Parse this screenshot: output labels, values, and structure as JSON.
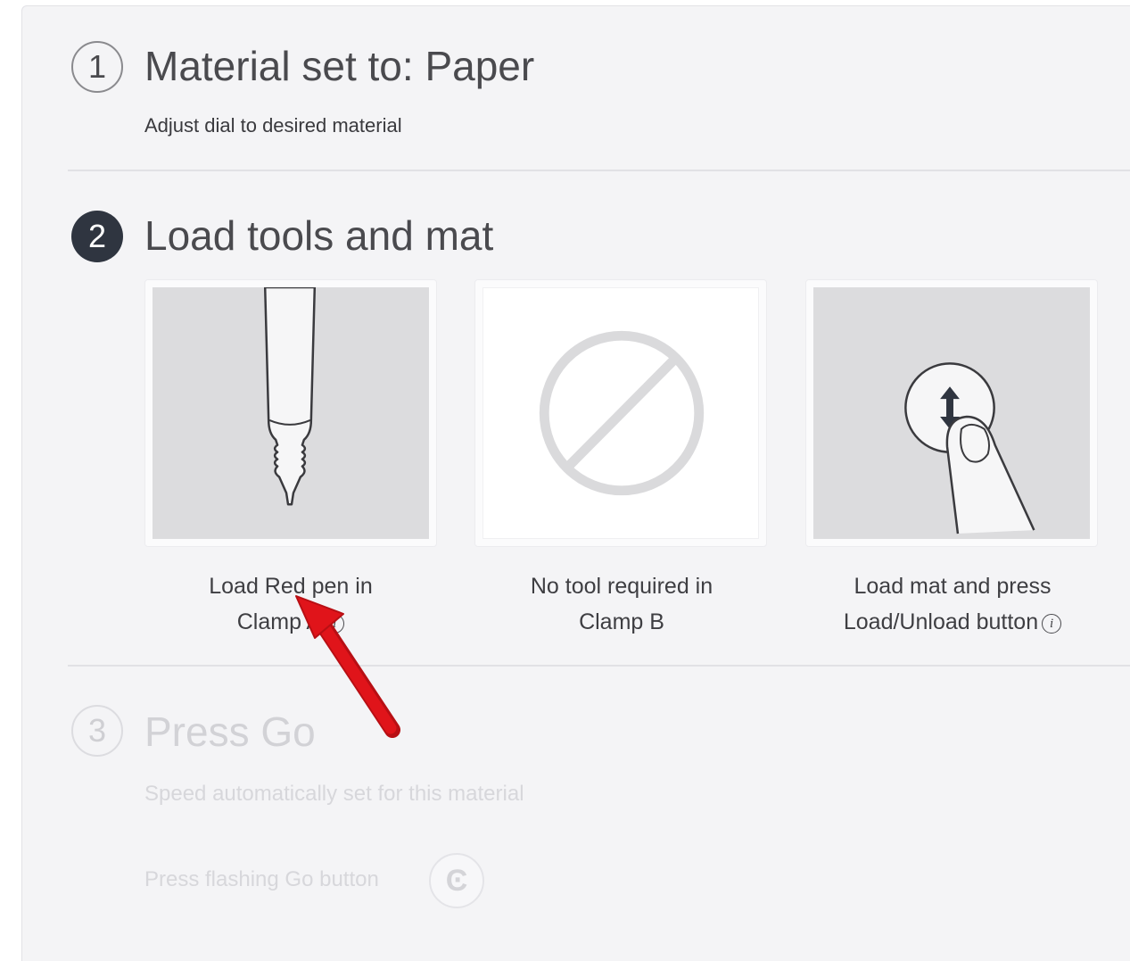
{
  "steps": [
    {
      "number": "1",
      "title": "Material set to: Paper",
      "subtitle": "Adjust dial to desired material"
    },
    {
      "number": "2",
      "title": "Load tools and mat"
    },
    {
      "number": "3",
      "title": "Press Go",
      "subtitle": "Speed automatically set for this material",
      "go_prompt": "Press flashing Go button"
    }
  ],
  "tool_cards": [
    {
      "caption_line1": "Load Red pen in",
      "caption_line2": "Clamp A",
      "info": "i",
      "icon": "pen-icon"
    },
    {
      "caption_line1": "No tool required in",
      "caption_line2": "Clamp B",
      "icon": "no-tool-icon"
    },
    {
      "caption_line1": "Load mat and press",
      "caption_line2": "Load/Unload button",
      "info": "i",
      "icon": "load-button-press-icon"
    }
  ],
  "go_button_glyph": "Ͼ",
  "colors": {
    "active_step": "#2f3540",
    "annotation_arrow": "#e0141a",
    "panel": "#f4f4f6"
  }
}
